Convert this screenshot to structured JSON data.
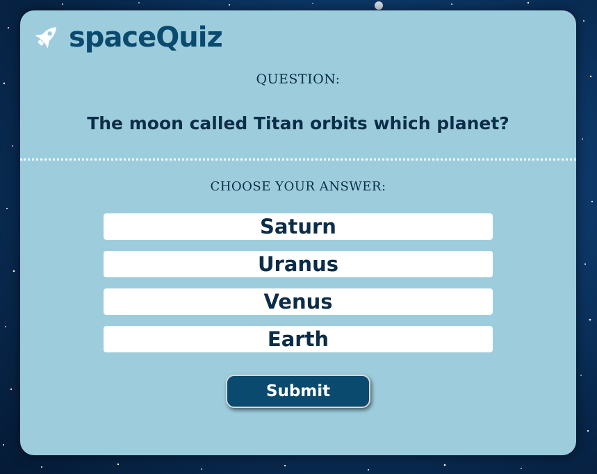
{
  "app": {
    "logo_text": "spaceQuiz",
    "logo_icon": "rocket-icon"
  },
  "question": {
    "heading": "QUESTION:",
    "text": "The moon called Titan orbits which planet?"
  },
  "answers": {
    "heading": "CHOOSE YOUR ANSWER:",
    "options": [
      "Saturn",
      "Uranus",
      "Venus",
      "Earth"
    ]
  },
  "submit": {
    "label": "Submit"
  },
  "colors": {
    "card_bg": "#9dcddc",
    "brand": "#0b4a6f",
    "text_dark": "#0c2d48",
    "answer_bg": "#ffffff",
    "space_bg": "#0f3f73"
  }
}
